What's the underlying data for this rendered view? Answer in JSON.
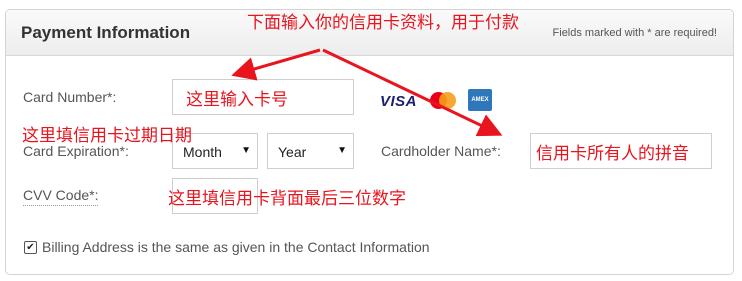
{
  "header": {
    "title": "Payment Information",
    "required_note": "Fields marked with * are required!"
  },
  "form": {
    "card_number_label": "Card Number*:",
    "expiration_label": "Card Expiration*:",
    "month_select": {
      "selected": "Month"
    },
    "year_select": {
      "selected": "Year"
    },
    "cardholder_label": "Cardholder Name*:",
    "cvv_label": "CVV Code*:",
    "billing_checkbox": {
      "checked": true,
      "label": "Billing Address is the same as given in the Contact Information"
    }
  },
  "card_logos": {
    "visa": "VISA",
    "mastercard": "mastercard-logo",
    "amex": "AMEX"
  },
  "annotations": {
    "top": "下面输入你的信用卡资料，用于付款",
    "card_number": "这里输入卡号",
    "expiration": "这里填信用卡过期日期",
    "cardholder": "信用卡所有人的拼音",
    "cvv": "这里填信用卡背面最后三位数字"
  },
  "colors": {
    "annotation_red": "#e8141e",
    "visa_blue": "#1a1f71",
    "amex_blue": "#2e77bb"
  },
  "icons": {
    "checkbox": "checkmark-icon",
    "select_caret": "caret-down-icon"
  }
}
